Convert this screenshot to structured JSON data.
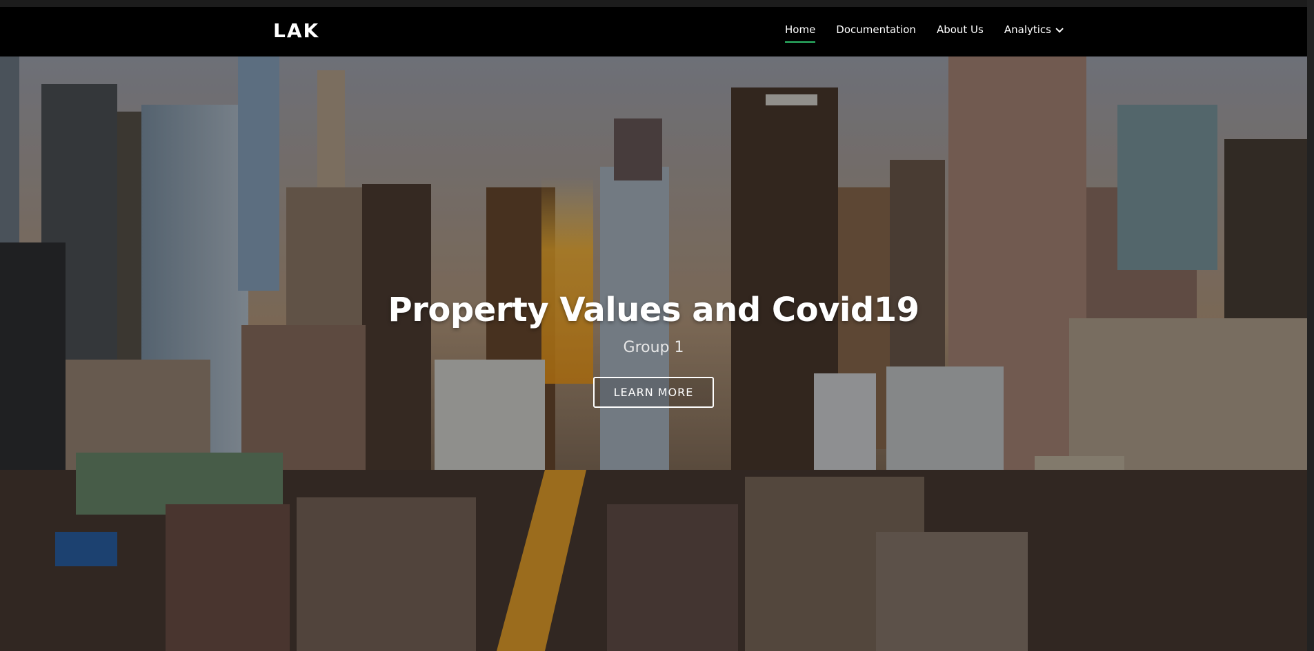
{
  "brand": {
    "logo": "LAK"
  },
  "nav": {
    "items": [
      {
        "label": "Home",
        "active": true
      },
      {
        "label": "Documentation"
      },
      {
        "label": "About Us"
      },
      {
        "label": "Analytics",
        "dropdown": true
      }
    ]
  },
  "hero": {
    "title": "Property Values and Covid19",
    "subtitle": "Group 1",
    "button_label": "LEARN MORE",
    "background": "city-skyline-photo"
  },
  "colors": {
    "active_underline": "#2ebd6b",
    "navbar_bg": "#000000"
  }
}
